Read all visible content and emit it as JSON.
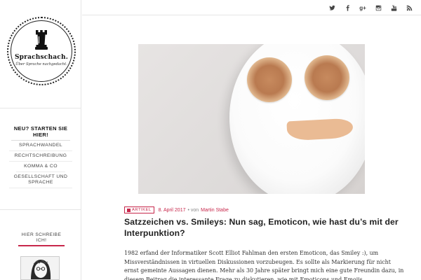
{
  "site": {
    "name": "Sprachschach.",
    "tagline": "Über Sprache nachgedacht."
  },
  "nav": {
    "heading": "NEU? STARTEN SIE HIER!",
    "items": [
      {
        "label": "SPRACHWANDEL"
      },
      {
        "label": "RECHTSCHREIBUNG"
      },
      {
        "label": "KOMMA & CO"
      },
      {
        "label": "GESELLSCHAFT UND SPRACHE"
      }
    ]
  },
  "author_box": {
    "heading": "HIER SCHREIBE ICH!"
  },
  "social": [
    {
      "icon": "twitter-icon"
    },
    {
      "icon": "facebook-icon"
    },
    {
      "icon": "google-plus-icon",
      "glyph": "g+"
    },
    {
      "icon": "instagram-icon"
    },
    {
      "icon": "youtube-icon"
    },
    {
      "icon": "rss-icon"
    }
  ],
  "post": {
    "category": "ARTIKEL",
    "date": "8. April 2017",
    "by": "• von",
    "author": "Martin Stabe",
    "title": "Satzzeichen vs. Smileys: Nun sag, Emoticon, wie hast du’s mit der Interpunktion?",
    "excerpt": "1982 erfand der Informatiker Scott Elliot Fahlman den ersten Emoticon, das Smiley :), um Missverständnissen in virtuellen Diskussionen vorzubeugen. Es sollte als Markierung für nicht ernst gemeinte Aussagen dienen. Mehr als 30 Jahre später bringt mich eine gute Freundin dazu, in diesem Beitrag die interessante Frage zu diskutieren, wie mit Emoticons und Emojis"
  },
  "colors": {
    "accent": "#c7274b",
    "border": "#e6e6e6"
  }
}
